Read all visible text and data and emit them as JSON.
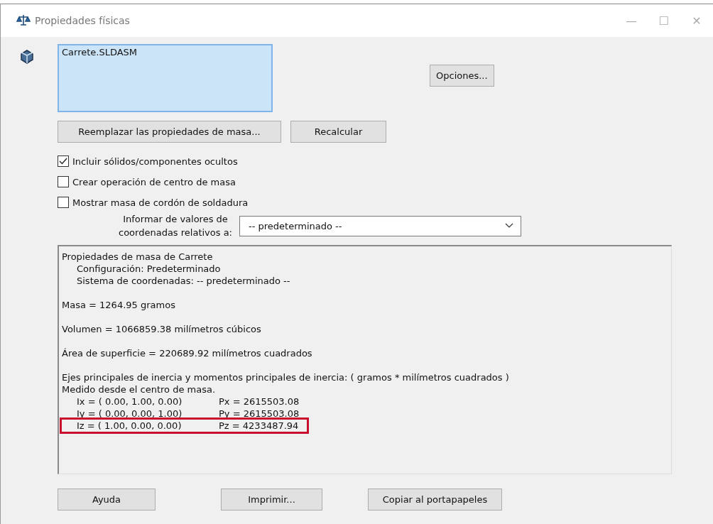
{
  "window": {
    "title": "Propiedades físicas",
    "controls": [
      "—",
      "☐",
      "✕"
    ]
  },
  "selection": {
    "items": [
      "Carrete.SLDASM"
    ]
  },
  "buttons_top": [
    {
      "label": "Opciones..."
    }
  ],
  "buttons_mid": [
    {
      "label": "Reemplazar las propiedades de masa..."
    },
    {
      "label": "Recalcular"
    }
  ],
  "options": [
    {
      "label": "Incluir sólidos/componentes ocultos",
      "checked": true
    },
    {
      "label": "Crear operación de centro de masa",
      "checked": false
    },
    {
      "label": "Mostrar masa de cordón de soldadura",
      "checked": false
    }
  ],
  "coordinates": {
    "label": "Informar de valores de coordenadas relativos a:",
    "value": "-- predeterminado --"
  },
  "results": {
    "paragraphs": [
      [
        {
          "kind": "plain",
          "text": "Propiedades de masa de Carrete"
        },
        {
          "kind": "indent",
          "text": "Configuración:  Predeterminado"
        },
        {
          "kind": "indent",
          "text": "Sistema de coordenadas:  -- predeterminado --"
        }
      ],
      [
        {
          "kind": "plain",
          "text": "Masa = 1264.95 gramos"
        }
      ],
      [
        {
          "kind": "plain",
          "text": "Volumen = 1066859.38 milímetros cúbicos"
        }
      ],
      [
        {
          "kind": "plain",
          "text": "Área de superficie = 220689.92  milímetros cuadrados"
        }
      ],
      [
        {
          "kind": "plain",
          "text": "Ejes principales de inercia y momentos principales de inercia: ( gramos *  milímetros cuadrados )"
        },
        {
          "kind": "plain",
          "text": "Medido desde el centro de masa."
        },
        {
          "kind": "axis",
          "axis": "Ix = ( 0.00,  1.00,  0.00)",
          "moment": "Px = 2615503.08",
          "highlighted": false
        },
        {
          "kind": "axis",
          "axis": "Iy = ( 0.00,  0.00,  1.00)",
          "moment": "Py = 2615503.08",
          "highlighted": false
        },
        {
          "kind": "axis",
          "axis": "Iz = ( 1.00,  0.00,  0.00)",
          "moment": "Pz = 4233487.94",
          "highlighted": true
        }
      ]
    ]
  },
  "buttons_bottom": [
    {
      "label": "Ayuda"
    },
    {
      "label": "Imprimir..."
    },
    {
      "label": "Copiar al portapapeles"
    }
  ]
}
